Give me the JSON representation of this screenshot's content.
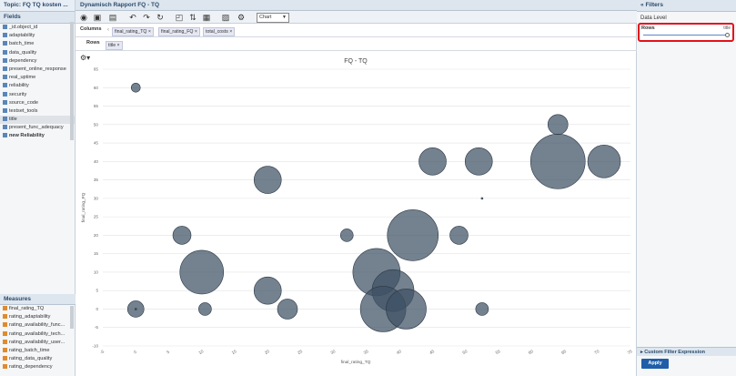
{
  "left_panel": {
    "topic_title": "Topic: FQ TQ kosten ...",
    "fields_header": "Fields",
    "fields": [
      "_id.object_id",
      "adaptability",
      "batch_time",
      "data_quality",
      "dependency",
      "present_online_response",
      "real_uptime",
      "reliability",
      "security",
      "source_code",
      "testset_tools",
      "title",
      "present_func_adequacy",
      "new Reliability"
    ],
    "measures_header": "Measures",
    "measures": [
      "final_rating_TQ",
      "rating_adaptability",
      "rating_availability_func...",
      "rating_availability_tech...",
      "rating_availability_user...",
      "rating_batch_time",
      "rating_data_quality",
      "rating_dependency"
    ]
  },
  "report": {
    "title": "Dynamisch Rapport FQ - TQ",
    "chart_type": "Chart",
    "columns_label": "Columns",
    "column_chips": [
      "final_rating_TQ",
      "final_rating_FQ",
      "total_costs"
    ],
    "rows_label": "Rows",
    "row_chips": [
      "title"
    ]
  },
  "right_panel": {
    "filters_header": "Filters",
    "data_level": "Data Level",
    "rows_label": "Rows",
    "rows_value": "title",
    "custom_filter": "Custom Filter Expression",
    "apply_label": "Apply"
  },
  "colors": {
    "bubble": "#3e5064",
    "accent": "#1f5ea8",
    "highlight": "#e2121b"
  },
  "chart_data": {
    "type": "scatter",
    "title": "FQ - TQ",
    "xlabel": "final_rating_TQ",
    "ylabel": "final_rating_FQ",
    "xlim": [
      -5,
      75
    ],
    "ylim": [
      -10,
      65
    ],
    "xticks": [
      -5,
      0,
      5,
      10,
      15,
      20,
      25,
      30,
      35,
      40,
      45,
      50,
      55,
      60,
      65,
      70,
      75
    ],
    "yticks": [
      -10,
      -5,
      0,
      5,
      10,
      15,
      20,
      25,
      30,
      35,
      40,
      45,
      50,
      55,
      60,
      65
    ],
    "grid": true,
    "points": [
      {
        "x": 0,
        "y": 60,
        "size": 5
      },
      {
        "x": 0,
        "y": 0,
        "size": 9
      },
      {
        "x": 0,
        "y": 0,
        "size": 1
      },
      {
        "x": 7,
        "y": 20,
        "size": 10
      },
      {
        "x": 10,
        "y": 10,
        "size": 24
      },
      {
        "x": 10.5,
        "y": 0,
        "size": 7
      },
      {
        "x": 20,
        "y": 35,
        "size": 15
      },
      {
        "x": 20,
        "y": 5,
        "size": 15
      },
      {
        "x": 23,
        "y": 0,
        "size": 11
      },
      {
        "x": 32,
        "y": 20,
        "size": 7
      },
      {
        "x": 36.5,
        "y": 10,
        "size": 26
      },
      {
        "x": 39,
        "y": 5,
        "size": 23
      },
      {
        "x": 37.5,
        "y": 0,
        "size": 25
      },
      {
        "x": 41,
        "y": 0,
        "size": 22
      },
      {
        "x": 42,
        "y": 20,
        "size": 28
      },
      {
        "x": 45,
        "y": 40,
        "size": 15
      },
      {
        "x": 49,
        "y": 20,
        "size": 10
      },
      {
        "x": 52,
        "y": 40,
        "size": 15
      },
      {
        "x": 52.5,
        "y": 30,
        "size": 1
      },
      {
        "x": 52.5,
        "y": 0,
        "size": 7
      },
      {
        "x": 64,
        "y": 40,
        "size": 30
      },
      {
        "x": 64,
        "y": 50,
        "size": 11
      },
      {
        "x": 71,
        "y": 40,
        "size": 18
      }
    ]
  }
}
